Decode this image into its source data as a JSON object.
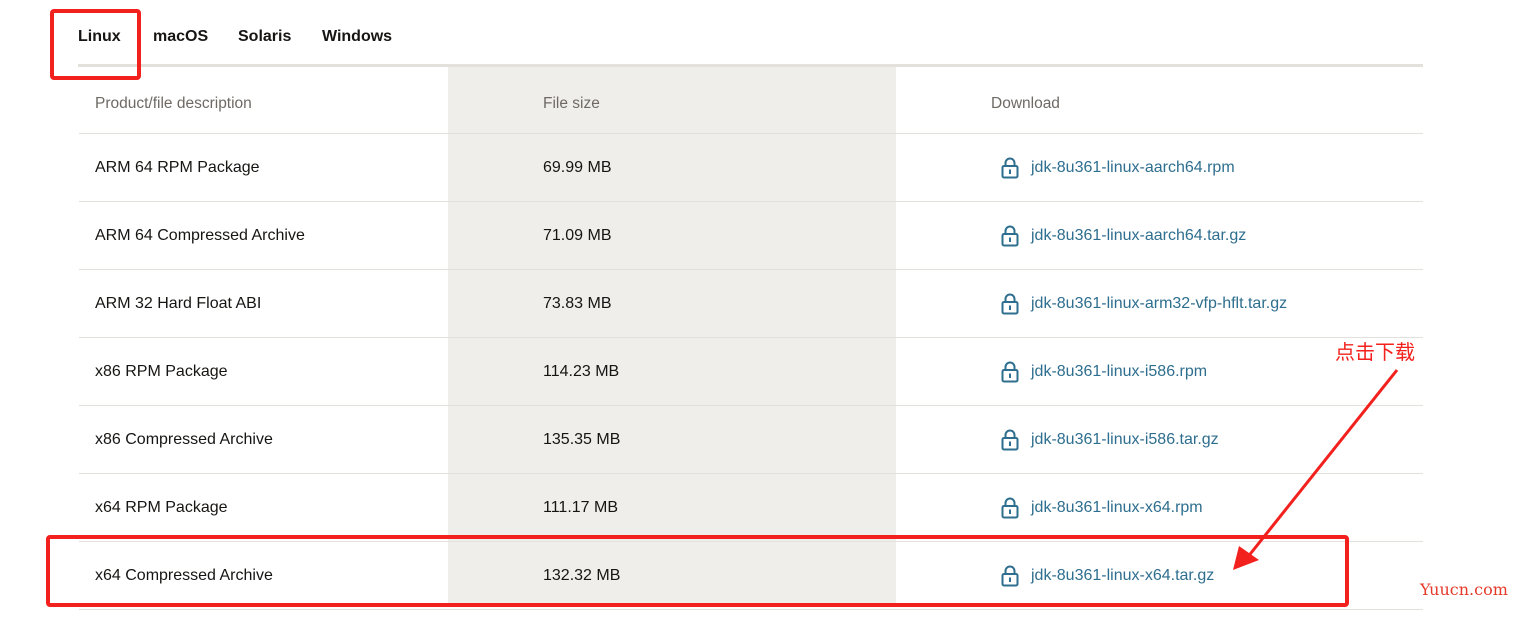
{
  "tabs": [
    {
      "label": "Linux",
      "active": true
    },
    {
      "label": "macOS",
      "active": false
    },
    {
      "label": "Solaris",
      "active": false
    },
    {
      "label": "Windows",
      "active": false
    }
  ],
  "table": {
    "headers": {
      "description": "Product/file description",
      "size": "File size",
      "download": "Download"
    },
    "rows": [
      {
        "description": "ARM 64 RPM Package",
        "size": "69.99 MB",
        "file": "jdk-8u361-linux-aarch64.rpm"
      },
      {
        "description": "ARM 64 Compressed Archive",
        "size": "71.09 MB",
        "file": "jdk-8u361-linux-aarch64.tar.gz"
      },
      {
        "description": "ARM 32 Hard Float ABI",
        "size": "73.83 MB",
        "file": "jdk-8u361-linux-arm32-vfp-hflt.tar.gz"
      },
      {
        "description": "x86 RPM Package",
        "size": "114.23 MB",
        "file": "jdk-8u361-linux-i586.rpm"
      },
      {
        "description": "x86 Compressed Archive",
        "size": "135.35 MB",
        "file": "jdk-8u361-linux-i586.tar.gz"
      },
      {
        "description": "x64 RPM Package",
        "size": "111.17 MB",
        "file": "jdk-8u361-linux-x64.rpm"
      },
      {
        "description": "x64 Compressed Archive",
        "size": "132.32 MB",
        "file": "jdk-8u361-linux-x64.tar.gz"
      }
    ]
  },
  "annotation": {
    "text": "点击下载",
    "color": "#f2211d"
  },
  "watermark": "Yuucn.com",
  "colors": {
    "link": "#2e6e8e",
    "tab_underline": "#5b7a4a",
    "size_column_bg": "#f0eeeb"
  },
  "icons": {
    "download": "lock-icon"
  }
}
